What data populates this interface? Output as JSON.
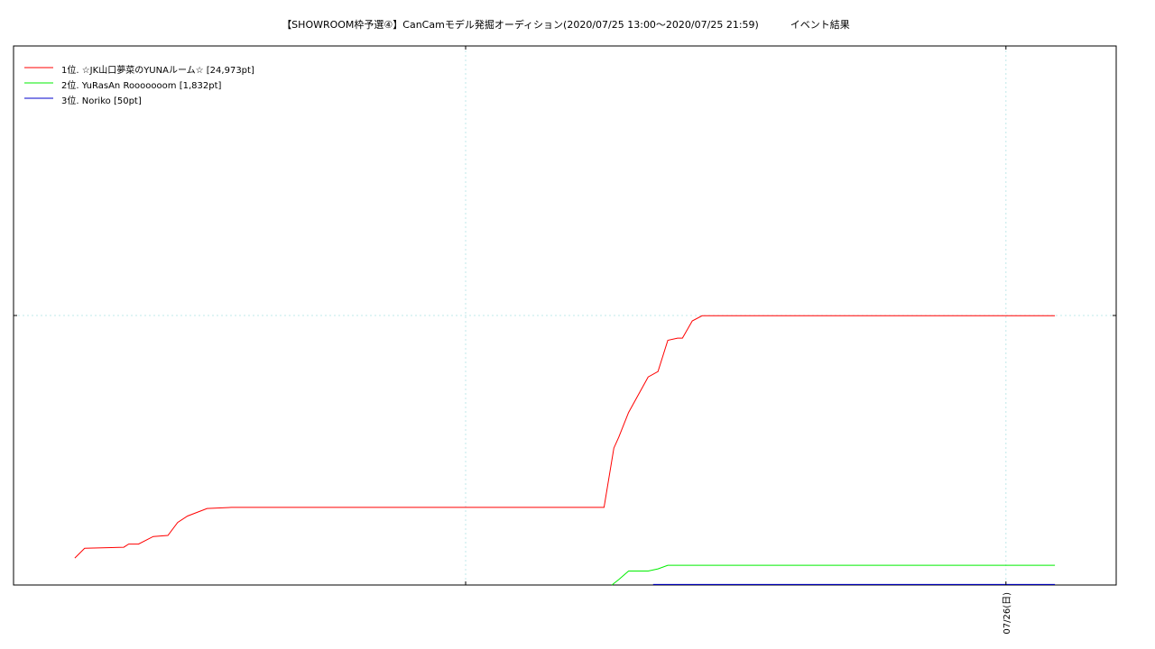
{
  "chart_data": {
    "type": "line",
    "title": "【SHOWROOM枠予選④】CanCamモデル発掘オーディション(2020/07/25 13:00〜2020/07/25 21:59)          イベント結果",
    "xlabel": "",
    "ylabel": "",
    "x_tick_labels": [
      "07/26(日)"
    ],
    "grid": true,
    "legend_position": "top-left",
    "series": [
      {
        "name": "1位. ☆JK山口夢菜のYUNAルーム☆ [24,973pt]",
        "color": "#ff0000",
        "points": [
          [
            0.0,
            2500
          ],
          [
            0.01,
            3400
          ],
          [
            0.05,
            3500
          ],
          [
            0.055,
            3800
          ],
          [
            0.065,
            3800
          ],
          [
            0.08,
            4500
          ],
          [
            0.095,
            4600
          ],
          [
            0.105,
            5800
          ],
          [
            0.115,
            6400
          ],
          [
            0.135,
            7100
          ],
          [
            0.16,
            7200
          ],
          [
            0.5,
            7200
          ],
          [
            0.54,
            7200
          ],
          [
            0.55,
            12700
          ],
          [
            0.555,
            13700
          ],
          [
            0.565,
            16000
          ],
          [
            0.585,
            19300
          ],
          [
            0.595,
            19800
          ],
          [
            0.605,
            22700
          ],
          [
            0.615,
            22900
          ],
          [
            0.62,
            22900
          ],
          [
            0.63,
            24500
          ],
          [
            0.64,
            24973
          ],
          [
            1.0,
            24973
          ]
        ]
      },
      {
        "name": "2位. YuRasAn Rooooooom [1,832pt]",
        "color": "#00ee00",
        "points": [
          [
            0.548,
            0
          ],
          [
            0.555,
            500
          ],
          [
            0.565,
            1300
          ],
          [
            0.585,
            1300
          ],
          [
            0.595,
            1500
          ],
          [
            0.605,
            1832
          ],
          [
            1.0,
            1832
          ]
        ]
      },
      {
        "name": "3位. Noriko [50pt]",
        "color": "#0000cc",
        "points": [
          [
            0.59,
            50
          ],
          [
            1.0,
            50
          ]
        ]
      }
    ],
    "ylim": [
      0,
      50000
    ],
    "xlim": [
      -0.0625,
      1.0625
    ]
  }
}
